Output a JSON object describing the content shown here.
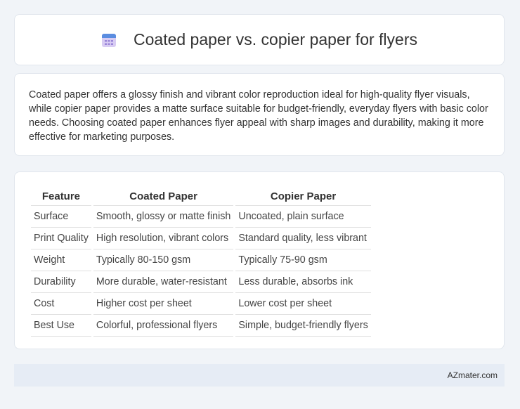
{
  "header": {
    "title": "Coated paper vs. copier paper for flyers",
    "icon": "calendar-icon"
  },
  "description": "Coated paper offers a glossy finish and vibrant color reproduction ideal for high-quality flyer visuals, while copier paper provides a matte surface suitable for budget-friendly, everyday flyers with basic color needs. Choosing coated paper enhances flyer appeal with sharp images and durability, making it more effective for marketing purposes.",
  "table": {
    "headers": [
      "Feature",
      "Coated Paper",
      "Copier Paper"
    ],
    "rows": [
      [
        "Surface",
        "Smooth, glossy or matte finish",
        "Uncoated, plain surface"
      ],
      [
        "Print Quality",
        "High resolution, vibrant colors",
        "Standard quality, less vibrant"
      ],
      [
        "Weight",
        "Typically 80-150 gsm",
        "Typically 75-90 gsm"
      ],
      [
        "Durability",
        "More durable, water-resistant",
        "Less durable, absorbs ink"
      ],
      [
        "Cost",
        "Higher cost per sheet",
        "Lower cost per sheet"
      ],
      [
        "Best Use",
        "Colorful, professional flyers",
        "Simple, budget-friendly flyers"
      ]
    ]
  },
  "footer": {
    "brand": "AZmater.com"
  },
  "colors": {
    "background": "#f1f4f8",
    "card": "#ffffff",
    "footer": "#e6ecf5",
    "icon_top": "#5b8de0",
    "icon_body": "#c9b8ee"
  }
}
